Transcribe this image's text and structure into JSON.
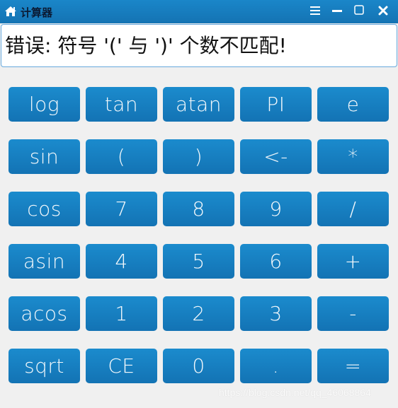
{
  "window": {
    "title": "计算器",
    "icon": "home-icon",
    "controls": [
      "menu-icon",
      "minimize-icon",
      "maximize-icon",
      "close-icon"
    ]
  },
  "display": {
    "value": "错误: 符号 '(' 与 ')' 个数不匹配!"
  },
  "keypad": {
    "rows": [
      [
        "log",
        "tan",
        "atan",
        "PI",
        "e"
      ],
      [
        "sin",
        "(",
        ")",
        "<-",
        "*"
      ],
      [
        "cos",
        "7",
        "8",
        "9",
        "/"
      ],
      [
        "asin",
        "4",
        "5",
        "6",
        "+"
      ],
      [
        "acos",
        "1",
        "2",
        "3",
        "-"
      ],
      [
        "sqrt",
        "CE",
        "0",
        ".",
        "="
      ]
    ]
  },
  "watermark": "https://blog.csdn.net/qq_46068864",
  "colors": {
    "accent": "#1a86c9",
    "key_top": "#1b8bcd",
    "key_bottom": "#1373b4",
    "background": "#f0f0f0"
  }
}
